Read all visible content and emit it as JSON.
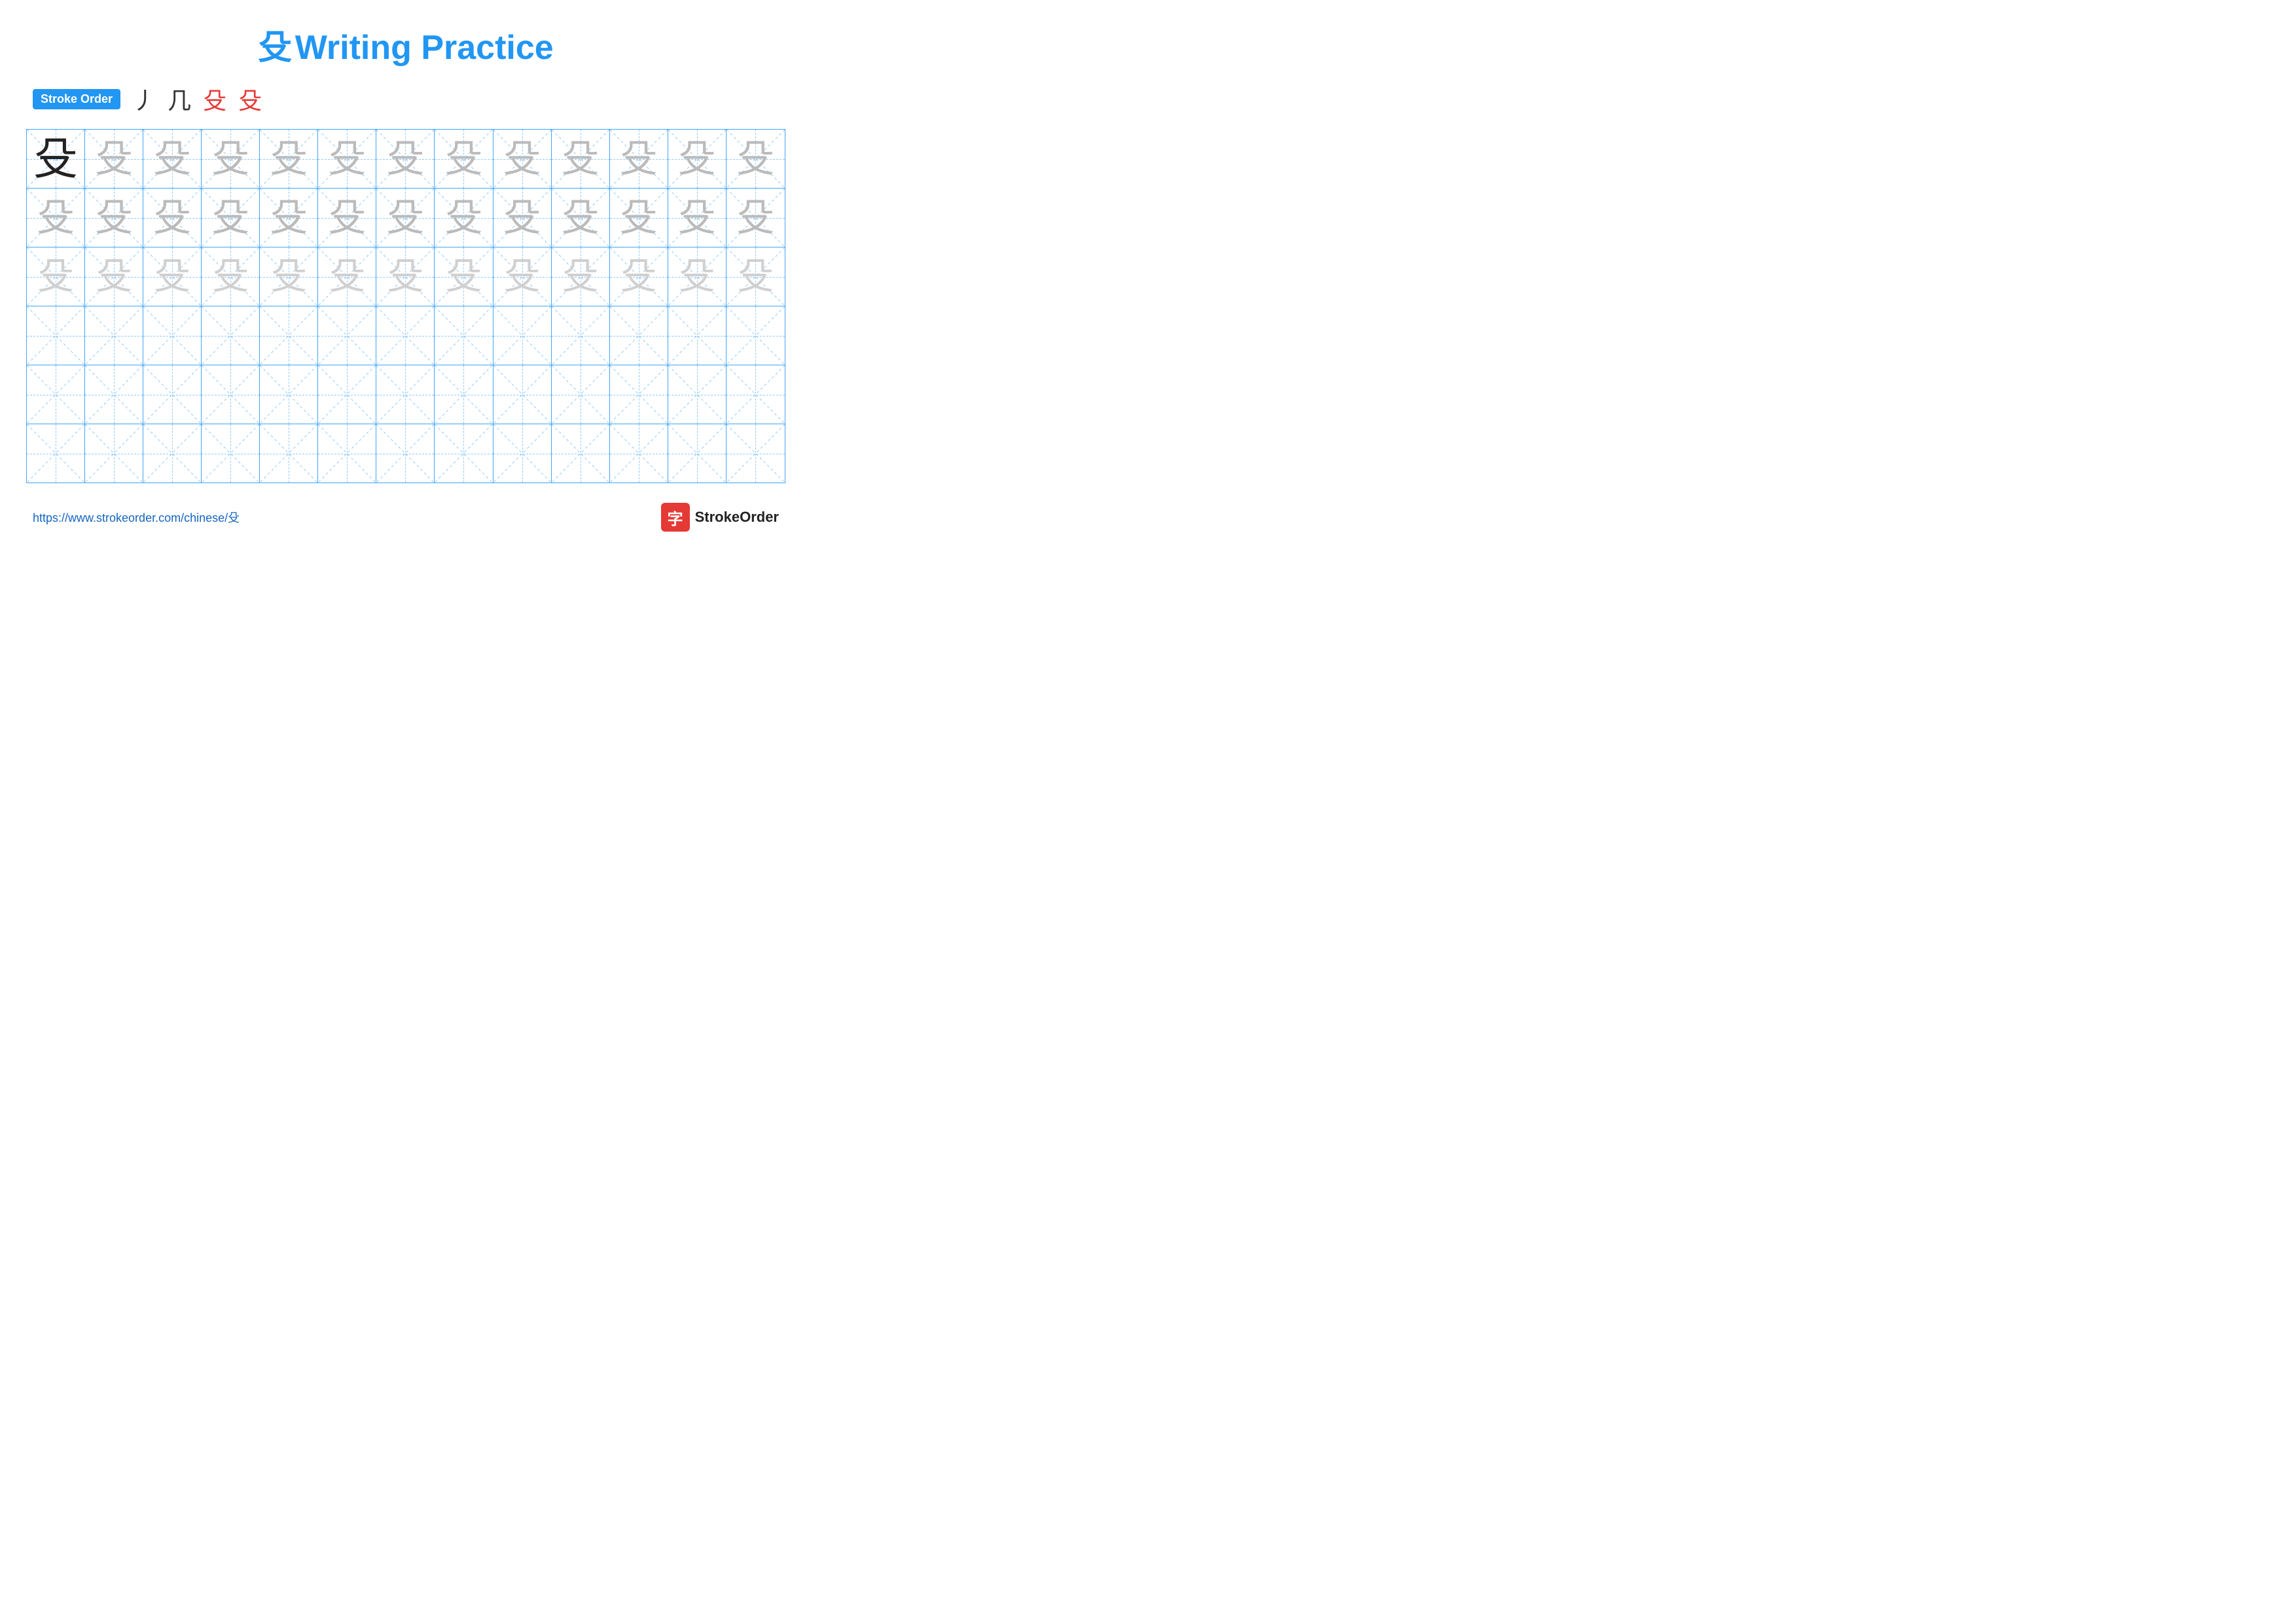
{
  "title": {
    "char": "殳",
    "text": "Writing Practice"
  },
  "stroke_order": {
    "badge": "Stroke Order",
    "steps": [
      "丿",
      "几",
      "殳",
      "殳"
    ]
  },
  "grid": {
    "rows": 6,
    "cols": 13,
    "char": "殳",
    "row_types": [
      "model",
      "dark_fade",
      "light_fade",
      "empty",
      "empty",
      "empty"
    ]
  },
  "footer": {
    "url": "https://www.strokeorder.com/chinese/殳",
    "logo_char": "字",
    "logo_name": "StrokeOrder"
  }
}
